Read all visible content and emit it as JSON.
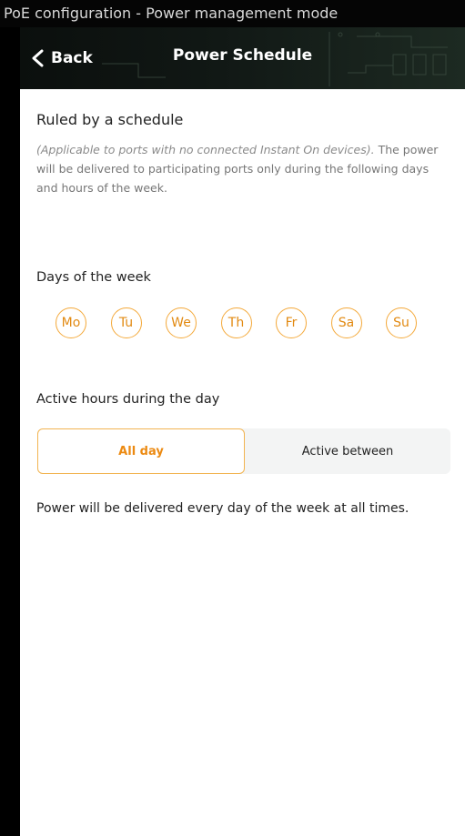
{
  "window": {
    "caption": "PoE configuration - Power management mode"
  },
  "navbar": {
    "back_label": "Back",
    "title": "Power Schedule"
  },
  "schedule": {
    "heading": "Ruled by a schedule",
    "note_italic": "(Applicable to ports with no connected Instant On devices).",
    "note_text": "The power will be delivered to participating ports only during the following days and hours of the week."
  },
  "days": {
    "heading": "Days of the week",
    "items": [
      "Mo",
      "Tu",
      "We",
      "Th",
      "Fr",
      "Sa",
      "Su"
    ],
    "all_selected": true
  },
  "active_hours": {
    "heading": "Active hours during the day",
    "options": [
      "All day",
      "Active between"
    ],
    "selected": "All day"
  },
  "status_message": "Power will be delivered every day of the week at all times.",
  "colors": {
    "accent": "#f4a93a",
    "accent_text": "#e28a12",
    "navbar": "#111815"
  },
  "icons": {
    "back": "chevron-left-icon"
  }
}
